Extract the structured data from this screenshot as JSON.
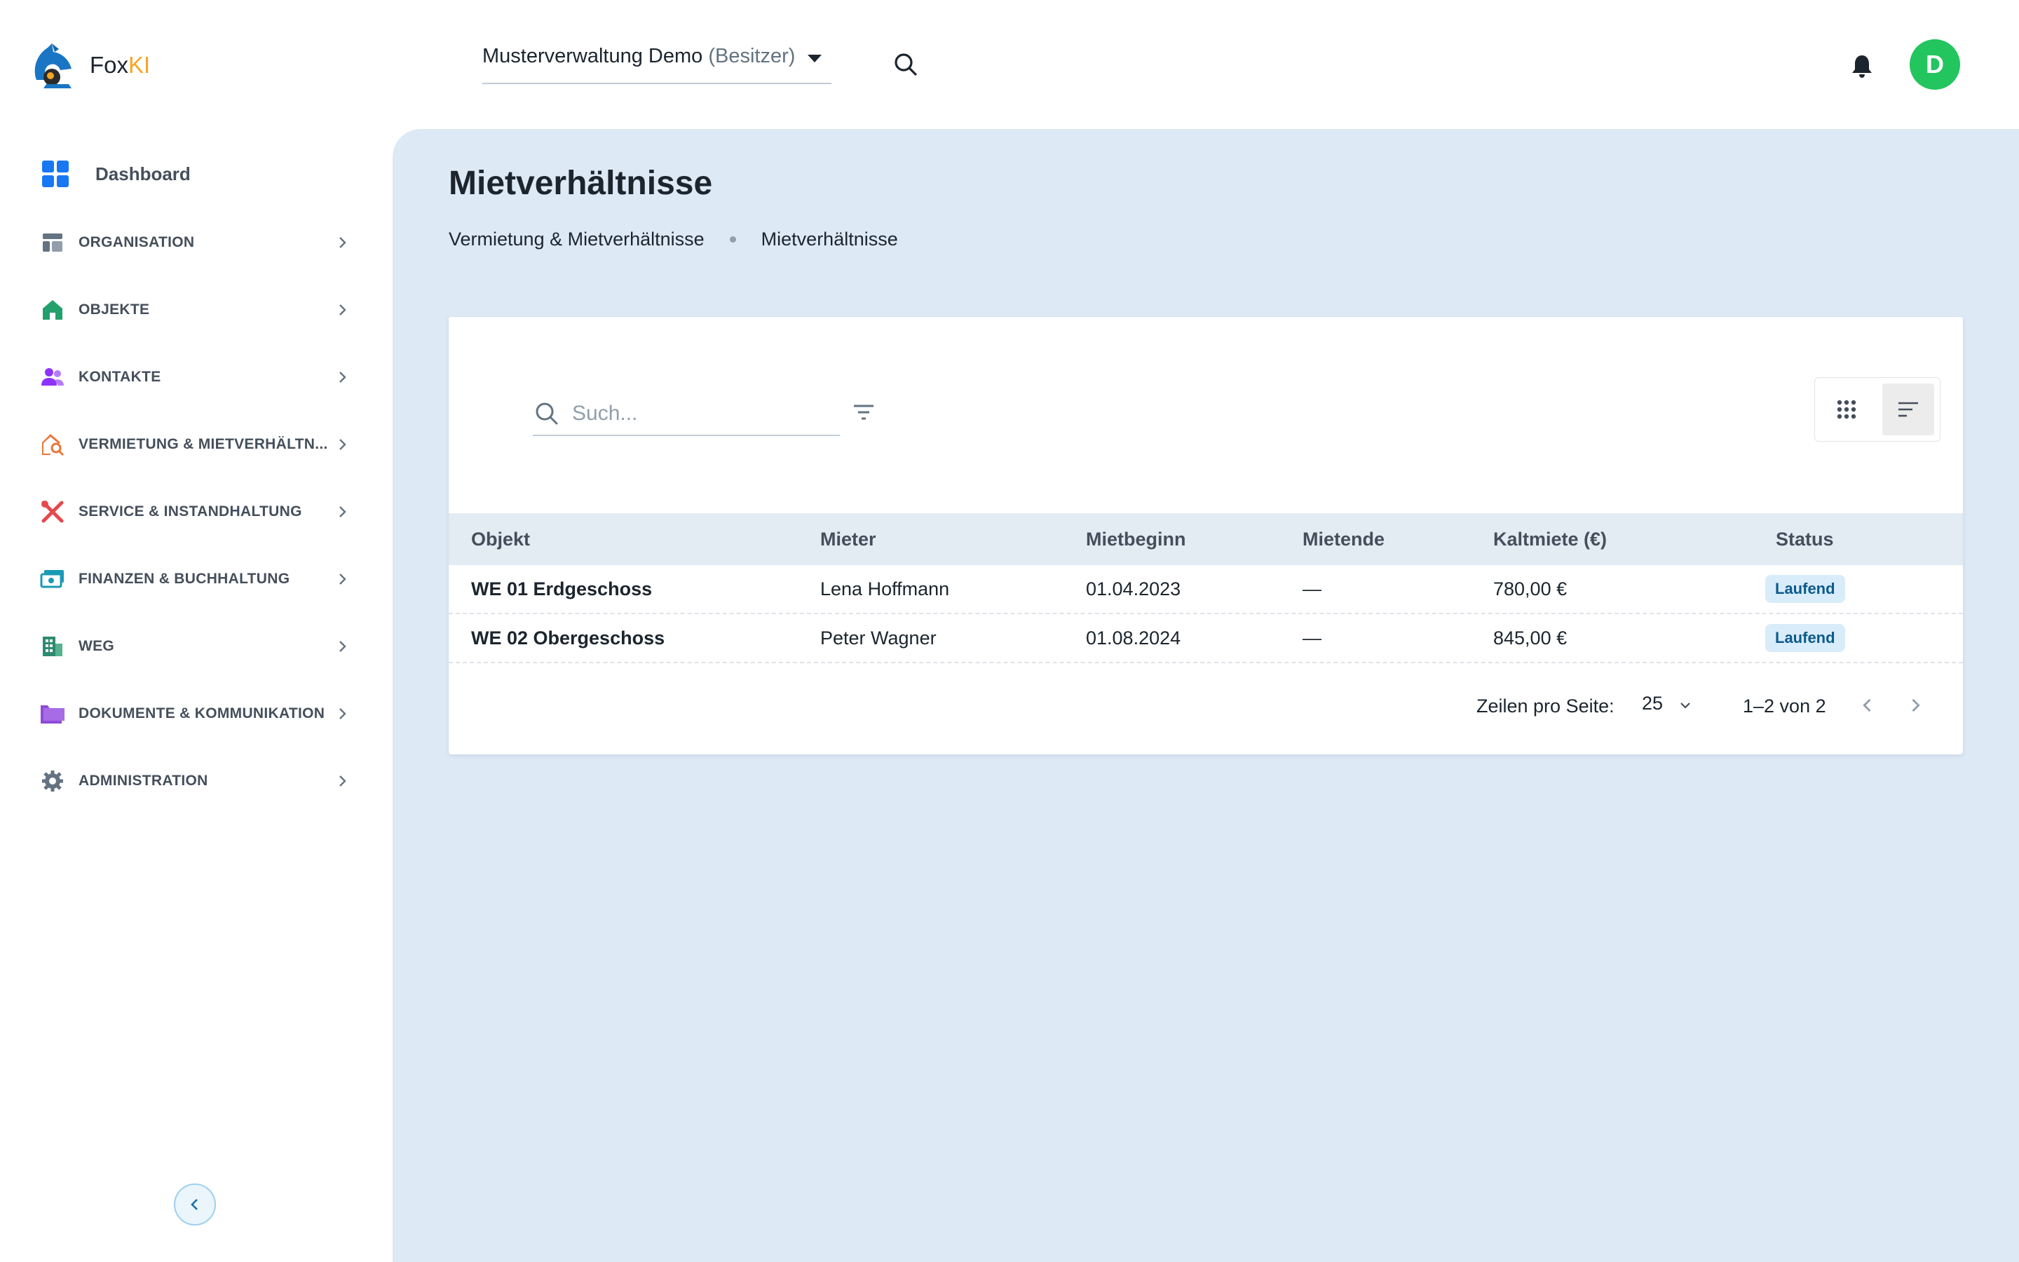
{
  "brand": {
    "name_prefix": "Fox",
    "name_suffix": "KI"
  },
  "header": {
    "org_name": "Musterverwaltung Demo",
    "org_role": "(Besitzer)",
    "avatar_initial": "D"
  },
  "sidebar": {
    "dashboard_label": "Dashboard",
    "items": [
      {
        "label": "ORGANISATION",
        "icon": "layout-icon",
        "color": "#637381"
      },
      {
        "label": "OBJEKTE",
        "icon": "home-icon",
        "color": "#22a06b"
      },
      {
        "label": "KONTAKTE",
        "icon": "people-icon",
        "color": "#8e33ff"
      },
      {
        "label": "VERMIETUNG & MIETVERHÄLTN...",
        "icon": "house-search-icon",
        "color": "#e8763a"
      },
      {
        "label": "SERVICE & INSTANDHALTUNG",
        "icon": "tools-icon",
        "color": "#e5484d"
      },
      {
        "label": "FINANZEN & BUCHHALTUNG",
        "icon": "money-icon",
        "color": "#1a9bb5"
      },
      {
        "label": "WEG",
        "icon": "building-icon",
        "color": "#2d8a6f"
      },
      {
        "label": "DOKUMENTE & KOMMUNIKATION",
        "icon": "folder-icon",
        "color": "#8e4bd6"
      },
      {
        "label": "ADMINISTRATION",
        "icon": "gear-icon",
        "color": "#637381"
      }
    ]
  },
  "page": {
    "title": "Mietverhältnisse",
    "breadcrumb": [
      "Vermietung & Mietverhältnisse",
      "Mietverhältnisse"
    ]
  },
  "table": {
    "search_placeholder": "Such...",
    "columns": [
      "Objekt",
      "Mieter",
      "Mietbeginn",
      "Mietende",
      "Kaltmiete (€)",
      "Status"
    ],
    "rows": [
      {
        "objekt": "WE 01 Erdgeschoss",
        "mieter": "Lena Hoffmann",
        "beginn": "01.04.2023",
        "ende": "—",
        "miete": "780,00 €",
        "status": "Laufend"
      },
      {
        "objekt": "WE 02 Obergeschoss",
        "mieter": "Peter Wagner",
        "beginn": "01.08.2024",
        "ende": "—",
        "miete": "845,00 €",
        "status": "Laufend"
      }
    ],
    "rows_per_page_label": "Zeilen pro Seite:",
    "rows_per_page_value": "25",
    "range_label": "1–2 von 2"
  },
  "colors": {
    "accent": "#1877f2",
    "avatar": "#22c55e",
    "main_bg": "#dde9f5",
    "ki": "#f5a524"
  }
}
